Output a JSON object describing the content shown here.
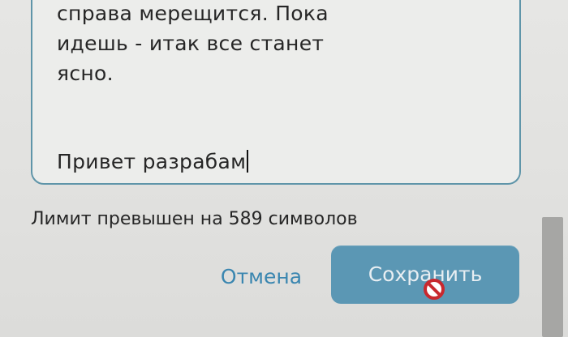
{
  "editor": {
    "lines": [
      "справа мерещится. Пока",
      "идешь - итак все станет",
      "ясно."
    ],
    "current_input": "Привет разрабам"
  },
  "status": {
    "limit_message": "Лимит превышен на 589 символов"
  },
  "actions": {
    "cancel_label": "Отмена",
    "save_label": "Сохранить"
  },
  "colors": {
    "accent": "#5b97b4",
    "link": "#3a86b0",
    "border": "#5f95a9",
    "background": "#e3e3e1"
  },
  "icons": {
    "cursor": "not-allowed-icon"
  }
}
